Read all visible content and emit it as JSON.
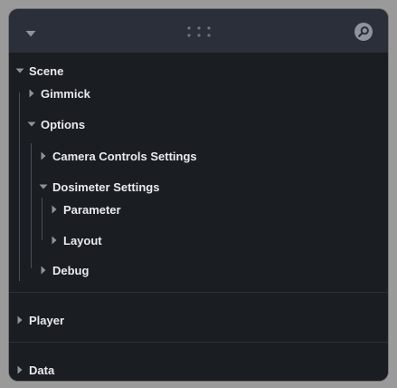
{
  "window": {
    "collapse_icon": "caret-down-icon",
    "drag_icon": "grip-dots-icon",
    "search_icon": "search-icon"
  },
  "tree": {
    "scene": {
      "label": "Scene",
      "expanded": true,
      "gimmick": {
        "label": "Gimmick",
        "expanded": false
      },
      "options": {
        "label": "Options",
        "expanded": true,
        "camera_controls": {
          "label": "Camera Controls Settings",
          "expanded": false
        },
        "dosimeter": {
          "label": "Dosimeter Settings",
          "expanded": true,
          "parameter": {
            "label": "Parameter",
            "expanded": false
          },
          "layout": {
            "label": "Layout",
            "expanded": false
          }
        },
        "debug": {
          "label": "Debug",
          "expanded": false
        }
      }
    },
    "player": {
      "label": "Player",
      "expanded": false
    },
    "data": {
      "label": "Data",
      "expanded": false
    }
  },
  "colors": {
    "background": "#9a9a9a",
    "titlebar": "#2b2f3a",
    "panel": "#1a1d22",
    "text": "#e8eaee",
    "icon": "#8e939c",
    "guide_line": "#4a4e57",
    "separator": "#2c3038"
  }
}
